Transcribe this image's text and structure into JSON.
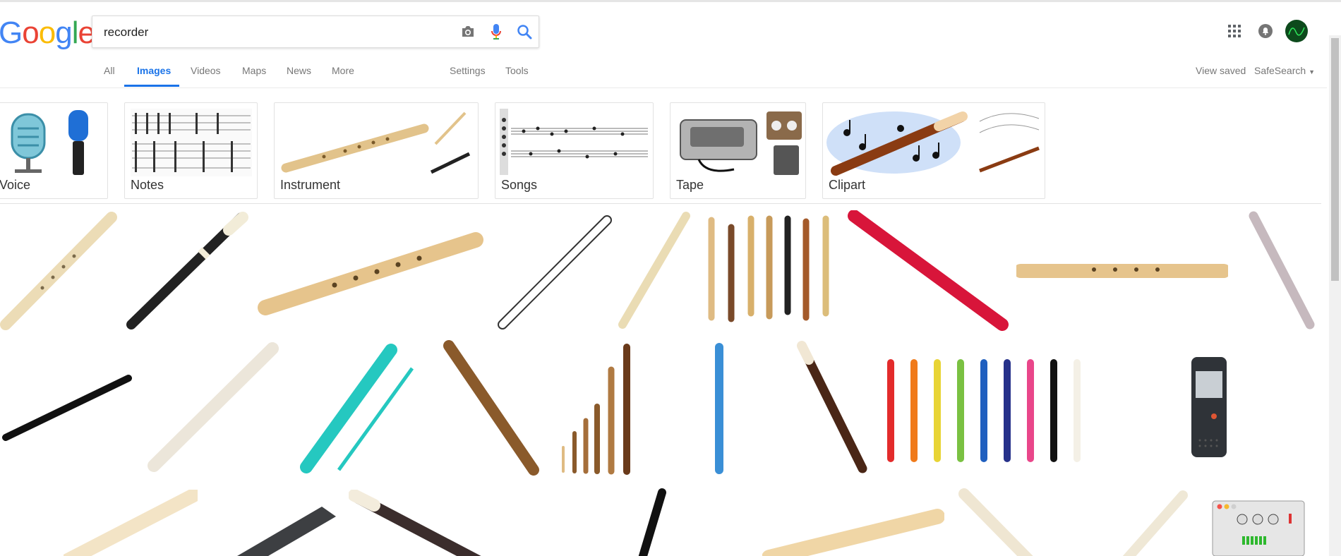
{
  "logo": {
    "letters": [
      "G",
      "o",
      "o",
      "g",
      "l",
      "e"
    ],
    "colors": [
      "#4285f4",
      "#ea4335",
      "#fbbc05",
      "#4285f4",
      "#34a853",
      "#ea4335"
    ]
  },
  "search": {
    "value": "recorder",
    "placeholder": "",
    "camera_icon": "camera-icon",
    "mic_icon": "microphone-icon",
    "search_icon": "search-icon"
  },
  "header_icons": {
    "apps": "apps-grid-icon",
    "notifications": "notifications-bell-icon",
    "account": "account-avatar"
  },
  "tabs": {
    "items": [
      "All",
      "Images",
      "Videos",
      "Maps",
      "News",
      "More",
      "Settings",
      "Tools"
    ],
    "active": "Images",
    "right": {
      "view_saved": "View saved",
      "safesearch": "SafeSearch"
    }
  },
  "suggestions": [
    "Voice",
    "Notes",
    "Instrument",
    "Songs",
    "Tape",
    "Clipart"
  ],
  "colors": {
    "accent": "#1a73e8",
    "wood": "#e9d3a2",
    "black": "#222222",
    "red": "#d8153a",
    "teal": "#25c8c0",
    "blue": "#3a8fd6",
    "brown": "#8a5a2b",
    "rainbow": [
      "#e32b2b",
      "#f07a1a",
      "#e8d435",
      "#7ac142",
      "#1f5fbf",
      "#26318a",
      "#e9468a",
      "#111111",
      "#f4f0e6"
    ]
  }
}
